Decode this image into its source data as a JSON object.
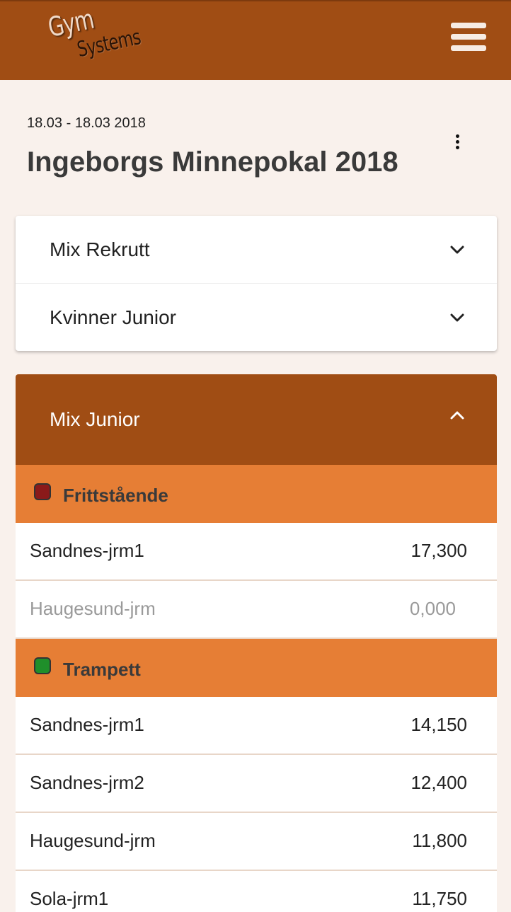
{
  "header": {
    "logo_line1": "Gym",
    "logo_line2": "Systems"
  },
  "event": {
    "date_range": "18.03 - 18.03 2018",
    "title": "Ingeborgs Minnepokal 2018"
  },
  "classes_collapsed": [
    {
      "label": "Mix Rekrutt"
    },
    {
      "label": "Kvinner Junior"
    }
  ],
  "class_expanded": {
    "label": "Mix Junior",
    "apparatus": [
      {
        "name": "Frittstående",
        "color": "#8b1a1a",
        "results": [
          {
            "team": "Sandnes-jrm1",
            "score": "17,300",
            "muted": false
          },
          {
            "team": "Haugesund-jrm",
            "score": "0,000",
            "muted": true
          }
        ]
      },
      {
        "name": "Trampett",
        "color": "#1f8f2a",
        "results": [
          {
            "team": "Sandnes-jrm1",
            "score": "14,150",
            "muted": false
          },
          {
            "team": "Sandnes-jrm2",
            "score": "12,400",
            "muted": false
          },
          {
            "team": "Haugesund-jrm",
            "score": "11,800",
            "muted": false
          },
          {
            "team": "Sola-jrm1",
            "score": "11,750",
            "muted": false
          }
        ]
      }
    ]
  },
  "colors": {
    "primary": "#a04d14",
    "accent": "#e67e35",
    "background": "#f9f1ec"
  },
  "icons": {
    "menu": "hamburger-menu-icon",
    "more": "kebab-menu-icon",
    "expand": "chevron-down-icon",
    "collapse": "chevron-up-icon"
  }
}
